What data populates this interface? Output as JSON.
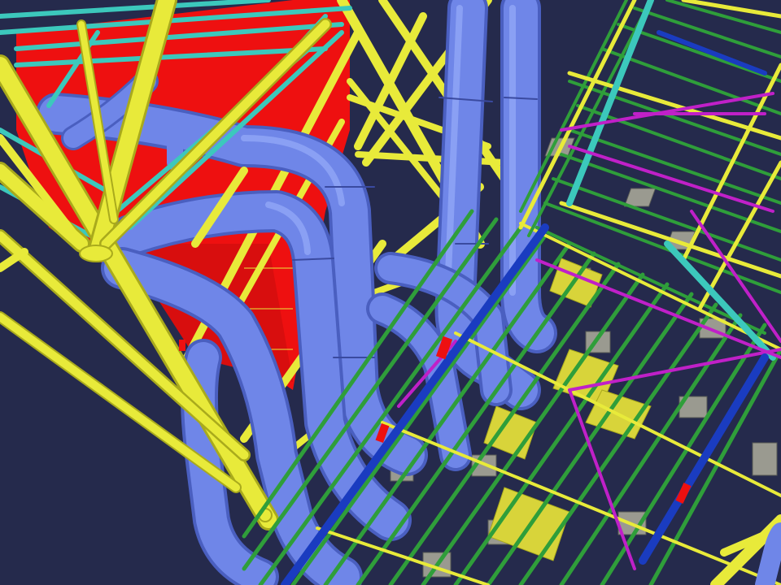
{
  "scene": {
    "background_color": "#252a4c",
    "colors": {
      "frame_yellow": "#e8ea3a",
      "frame_yellow_dark": "#a9aa1c",
      "grating_green": "#2f9e3a",
      "pipe_blue": "#6f86e8",
      "pipe_blue_dark": "#4a5fc0",
      "tank_red": "#ee1010",
      "bracing_teal": "#3cc8bc",
      "bracing_magenta": "#c020c8",
      "beam_blue": "#1a3cc0",
      "support_gray": "#9a9a90",
      "support_dark": "#585a55",
      "pad_yellow": "#d8d43a"
    },
    "objects": [
      {
        "name": "red-tank-panel",
        "icon": "tank"
      },
      {
        "name": "yellow-structural-frame",
        "icon": "truss"
      },
      {
        "name": "teal-bracing",
        "icon": "truss"
      },
      {
        "name": "blue-pipe-bundle",
        "icon": "pipe"
      },
      {
        "name": "green-grating-platform",
        "icon": "grating"
      },
      {
        "name": "magenta-bracing",
        "icon": "truss"
      },
      {
        "name": "gray-supports",
        "icon": "support"
      }
    ]
  }
}
